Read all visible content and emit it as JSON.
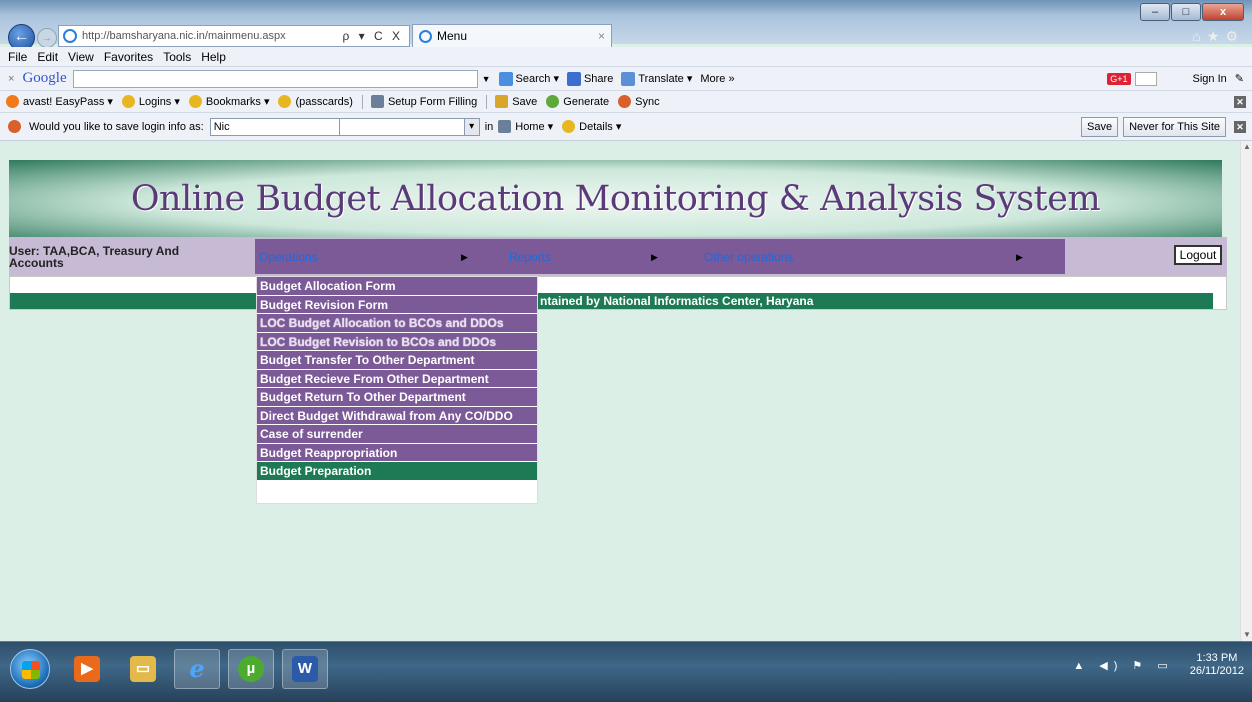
{
  "browser": {
    "address": "http://bamsharyana.nic.in/mainmenu.aspx",
    "address_tools": "ρ ▾ C X",
    "tab_title": "Menu",
    "tab_close": "×",
    "window_buttons": [
      "–",
      "□",
      "x"
    ],
    "menu": [
      "File",
      "Edit",
      "View",
      "Favorites",
      "Tools",
      "Help"
    ],
    "google_toolbar": {
      "close": "×",
      "logo": "Google",
      "search": "Search ▾",
      "share": "Share",
      "translate": "Translate ▾",
      "more": "More »",
      "gplus": "G+1",
      "sign_in": "Sign In"
    },
    "favorites": [
      {
        "label": "avast! EasyPass ▾",
        "color": "#f07a1a"
      },
      {
        "label": "Logins ▾",
        "color": "#e8b620"
      },
      {
        "label": "Bookmarks ▾",
        "color": "#e8b620"
      },
      {
        "label": "(passcards)",
        "color": "#e8b620"
      },
      {
        "label": "Setup Form Filling",
        "color": "#6b7f99"
      },
      {
        "label": "Save",
        "color": "#d9a52a"
      },
      {
        "label": "Generate",
        "color": "#5fa83a"
      },
      {
        "label": "Sync",
        "color": "#d9602a"
      }
    ],
    "password_bar": {
      "prompt": "Would you like to save login info as:",
      "login_value": "Nic",
      "in_label": "in",
      "home": "Home ▾",
      "details": "Details ▾",
      "save": "Save",
      "never": "Never for This Site"
    }
  },
  "page": {
    "banner_title": "Online Budget Allocation Monitoring & Analysis System",
    "user_label": "User: TAA,BCA, Treasury And Accounts",
    "top_menu": [
      "Operations",
      "Reports",
      "Other operations"
    ],
    "logout": "Logout",
    "footer": "ntained by National Informatics Center, Haryana",
    "operations_menu": [
      "Budget Allocation Form",
      "Budget Revision Form",
      "LOC Budget Allocation to BCOs and DDOs",
      "LOC Budget Revision to BCOs and DDOs",
      "Budget Transfer To Other Department",
      "Budget Recieve From Other Department",
      "Budget Return To Other Department",
      "Direct Budget Withdrawal from Any CO/DDO",
      "Case of surrender",
      "Budget Reappropriation",
      "Budget Preparation"
    ]
  },
  "taskbar": {
    "time": "1:33 PM",
    "date": "26/11/2012"
  }
}
